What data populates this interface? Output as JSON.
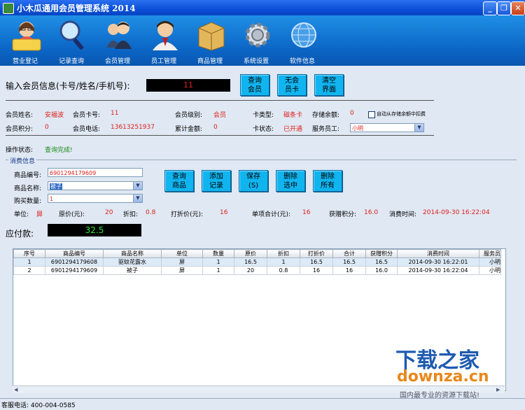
{
  "window": {
    "title": "小木瓜通用会员管理系统 2014"
  },
  "toolbar": {
    "items": [
      {
        "label": "营业登记"
      },
      {
        "label": "记录查询"
      },
      {
        "label": "会员管理"
      },
      {
        "label": "员工管理"
      },
      {
        "label": "商品管理"
      },
      {
        "label": "系统设置"
      },
      {
        "label": "软件信息"
      }
    ]
  },
  "search": {
    "label": "输入会员信息(卡号/姓名/手机号):",
    "value": "11",
    "btn_query": "查询\n会员",
    "btn_nocard": "无会\n员卡",
    "btn_clear": "清空\n界面"
  },
  "member": {
    "name_label": "会员姓名:",
    "name": "安福波",
    "card_label": "会员卡号:",
    "card": "11",
    "level_label": "会员级别:",
    "level": "会员",
    "cardtype_label": "卡类型:",
    "cardtype": "磁条卡",
    "balance_label": "存储余额:",
    "balance": "0",
    "autodeduct_label": "自动从存储余额中扣费",
    "points_label": "会员积分:",
    "points": "0",
    "phone_label": "会员电话:",
    "phone": "13613251937",
    "total_label": "累计金额:",
    "total": "0",
    "cardstatus_label": "卡状态:",
    "cardstatus": "已开通",
    "staff_label": "服务员工:",
    "staff": "小明"
  },
  "op": {
    "label": "操作状态:",
    "status": "查询完成!"
  },
  "consume": {
    "group_label": "消费信息",
    "code_label": "商品编号:",
    "code": "6901294179609",
    "name_label": "商品名称:",
    "name": "被子",
    "qty_label": "购买数量:",
    "qty": "1",
    "btn_query": "查询\n商品",
    "btn_add": "添加\n记录",
    "btn_save": "保存\n(S)",
    "btn_delsel": "删除\n选中",
    "btn_delall": "删除\n所有",
    "unit_label": "单位:",
    "unit": "屏",
    "price_label": "原价(元):",
    "price": "20",
    "discount_label": "折扣:",
    "discount": "0.8",
    "dprice_label": "打折价(元):",
    "dprice": "16",
    "subtotal_label": "单项合计(元):",
    "subtotal": "16",
    "gainpts_label": "获赠积分:",
    "gainpts": "16.0",
    "time_label": "消费时间:",
    "time": "2014-09-30 16:22:04",
    "pay_label": "应付款:",
    "pay": "32.5"
  },
  "table": {
    "headers": [
      "序号",
      "商品编号",
      "商品名称",
      "单位",
      "数量",
      "原价",
      "折扣",
      "打折价",
      "合计",
      "获赠积分",
      "消费时间",
      "服务员"
    ],
    "rows": [
      [
        "1",
        "6901294179608",
        "驱蚊花露水",
        "屏",
        "1",
        "16.5",
        "1",
        "16.5",
        "16.5",
        "16.5",
        "2014-09-30 16:22:01",
        "小明"
      ],
      [
        "2",
        "6901294179609",
        "被子",
        "屏",
        "1",
        "20",
        "0.8",
        "16",
        "16",
        "16.0",
        "2014-09-30 16:22:04",
        "小明"
      ]
    ]
  },
  "status": {
    "text": "客服电话: 400-004-0585"
  },
  "watermark": {
    "line1": "下载之家",
    "line2": "downza.cn",
    "line3": "国内最专业的资源下载站!"
  }
}
